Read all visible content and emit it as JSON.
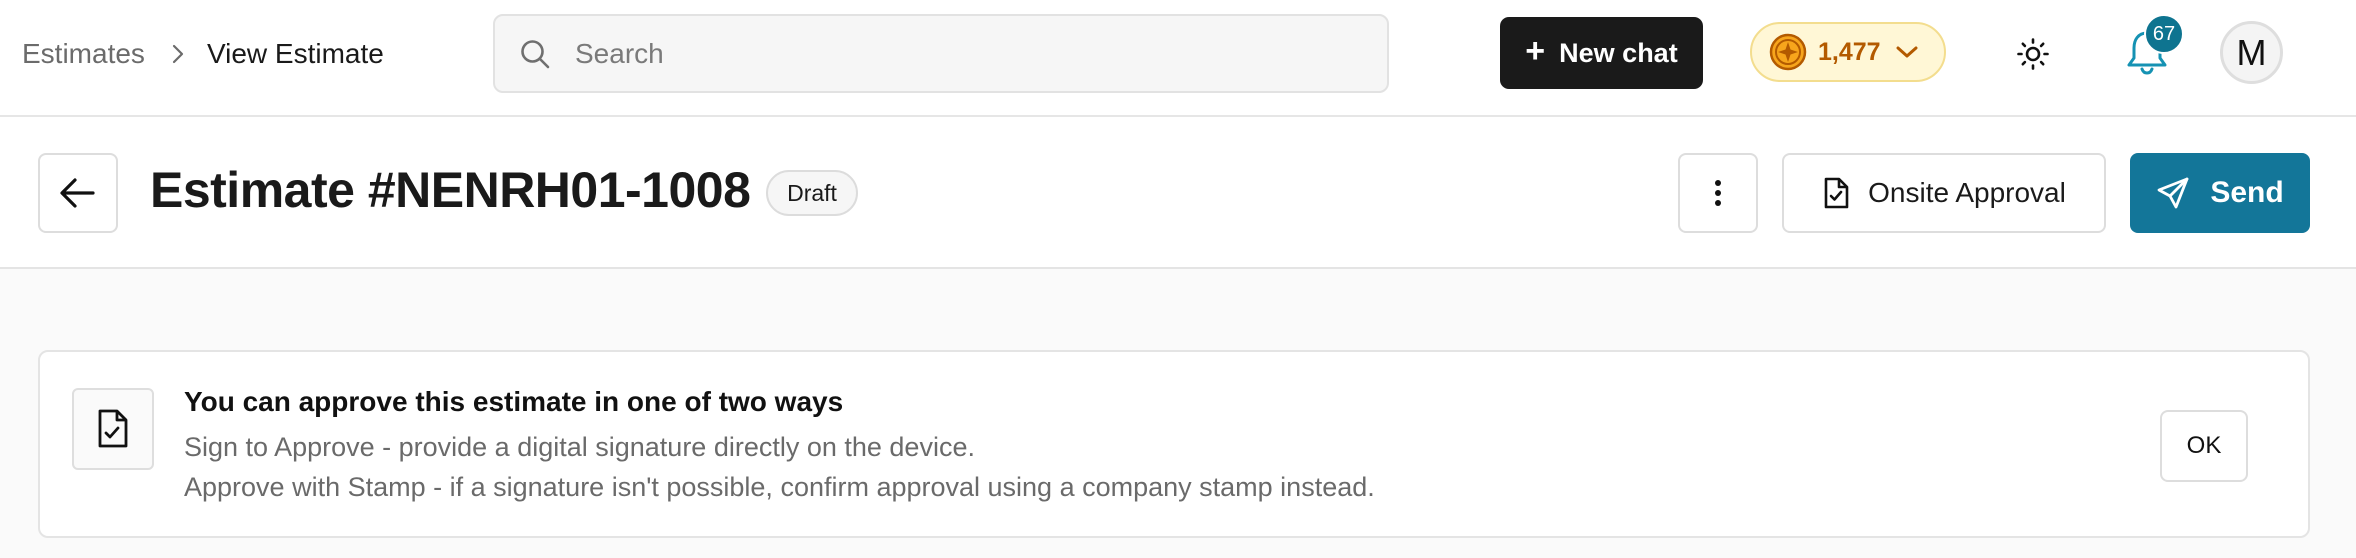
{
  "breadcrumb": {
    "items": [
      "Estimates",
      "View Estimate"
    ]
  },
  "search": {
    "placeholder": "Search",
    "value": ""
  },
  "toolbar": {
    "new_chat_label": "New chat",
    "credits_value": "1,477",
    "notifications_count": "67",
    "avatar_initial": "M"
  },
  "header": {
    "title": "Estimate #NENRH01-1008",
    "status": "Draft",
    "onsite_approval_label": "Onsite Approval",
    "send_label": "Send"
  },
  "info": {
    "title": "You can approve this estimate in one of two ways",
    "lines": [
      "Sign to Approve - provide a digital signature directly on the device.",
      "Approve with Stamp - if a signature isn't possible, confirm approval using a company stamp instead."
    ],
    "ok_label": "OK"
  },
  "colors": {
    "accent": "#137699",
    "notification_badge": "#0e7490",
    "credits_bg": "#fff7d6",
    "credits_text": "#b35a00",
    "new_chat_bg": "#1a1a1a"
  },
  "icons": {
    "search": "search-icon",
    "plus": "plus-icon",
    "coin": "coin-icon",
    "chevron": "chevron-down-icon",
    "theme": "sun-icon",
    "bell": "bell-icon",
    "back": "arrow-left-icon",
    "more": "more-vertical-icon",
    "document": "document-check-icon",
    "send": "send-icon"
  }
}
